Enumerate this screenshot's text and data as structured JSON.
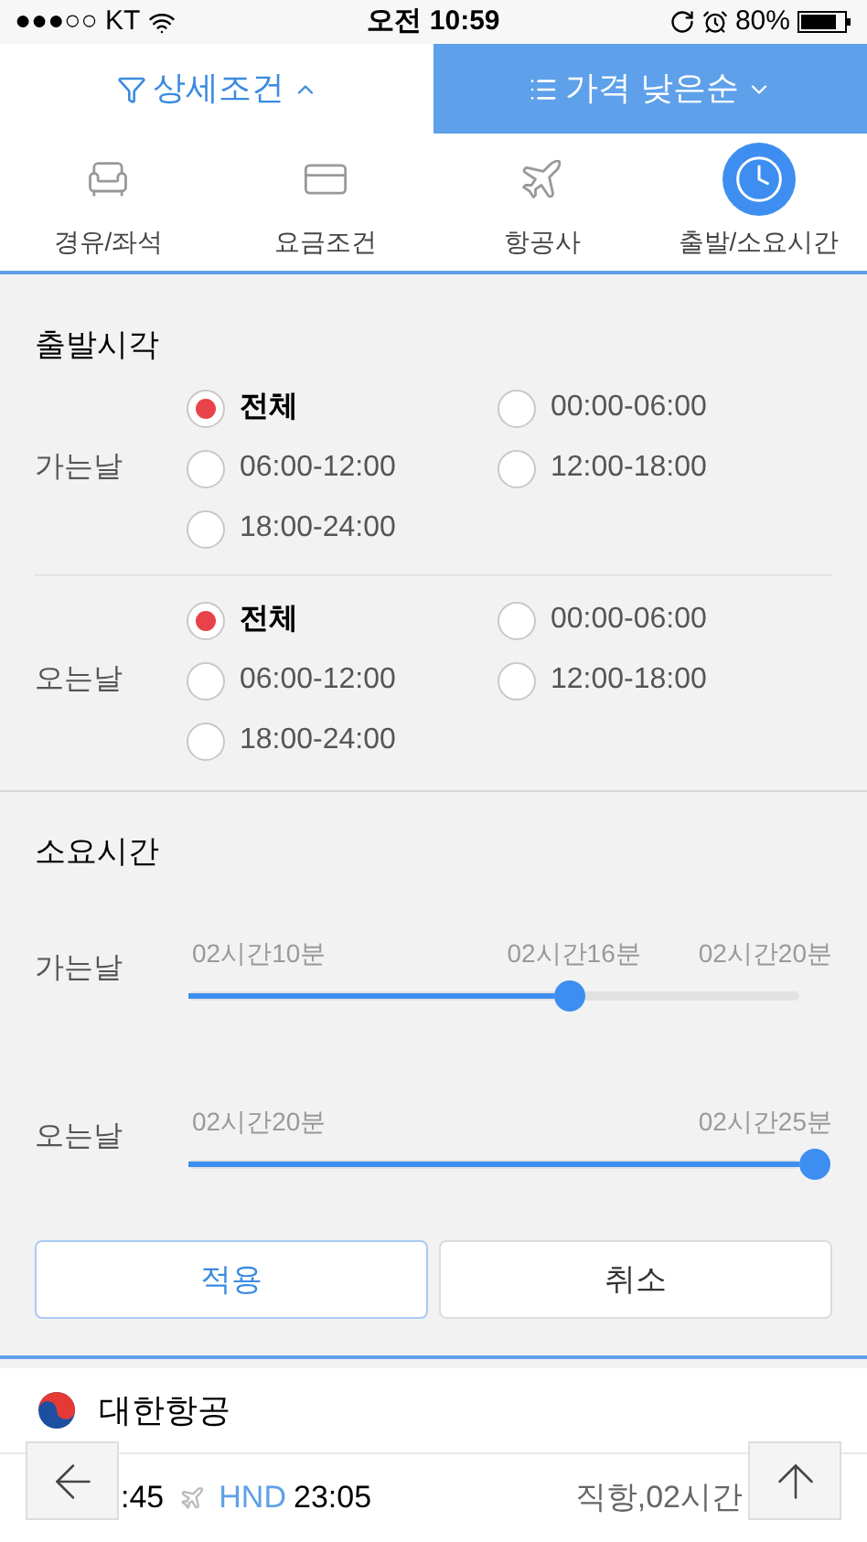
{
  "status_bar": {
    "carrier": "●●●○○ KT",
    "time": "오전 10:59",
    "battery": "80%"
  },
  "top_tabs": [
    {
      "label": "상세조건",
      "kind": "filter",
      "selected": false
    },
    {
      "label": "가격 낮은순",
      "kind": "sort",
      "selected": true
    }
  ],
  "categories": [
    {
      "label": "경유/좌석",
      "kind": "seat",
      "selected": false
    },
    {
      "label": "요금조건",
      "kind": "card",
      "selected": false
    },
    {
      "label": "항공사",
      "kind": "plane",
      "selected": false
    },
    {
      "label": "출발/소요시간",
      "kind": "clock",
      "selected": true
    }
  ],
  "departure_time": {
    "title": "출발시각",
    "groups": [
      {
        "label": "가는날",
        "options": [
          {
            "label": "전체",
            "selected": true
          },
          {
            "label": "00:00-06:00",
            "selected": false
          },
          {
            "label": "06:00-12:00",
            "selected": false
          },
          {
            "label": "12:00-18:00",
            "selected": false
          },
          {
            "label": "18:00-24:00",
            "selected": false
          }
        ]
      },
      {
        "label": "오는날",
        "options": [
          {
            "label": "전체",
            "selected": true
          },
          {
            "label": "00:00-06:00",
            "selected": false
          },
          {
            "label": "06:00-12:00",
            "selected": false
          },
          {
            "label": "12:00-18:00",
            "selected": false
          },
          {
            "label": "18:00-24:00",
            "selected": false
          }
        ]
      }
    ]
  },
  "duration": {
    "title": "소요시간",
    "sliders": [
      {
        "label": "가는날",
        "min": "02시간10분",
        "current": "02시간16분",
        "max": "02시간20분",
        "level": 0.6
      },
      {
        "label": "오는날",
        "min": "02시간20분",
        "max": "02시간25분",
        "level": 1
      }
    ]
  },
  "buttons": [
    {
      "label": "적용",
      "kind": "primary"
    },
    {
      "label": "취소",
      "kind": "secondary"
    }
  ],
  "result": {
    "airline": "대한항공",
    "departure_time": ":45",
    "arrival_airport": "HND",
    "arrival_time": "23:05",
    "summary": "직항,02시간"
  }
}
